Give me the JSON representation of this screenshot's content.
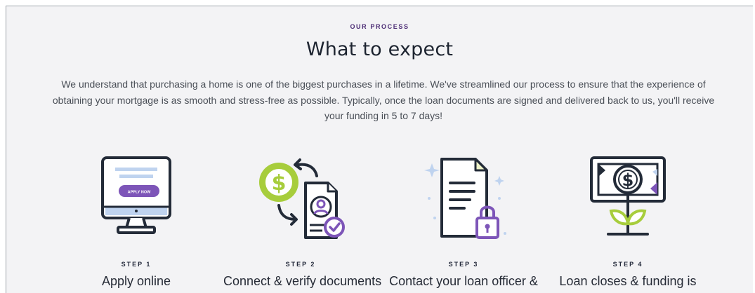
{
  "section": {
    "eyebrow": "OUR PROCESS",
    "title": "What to expect",
    "intro": "We understand that purchasing a home is one of the biggest purchases in a lifetime. We've streamlined our process to ensure that the experience of obtaining your mortgage is as smooth and stress-free as possible. Typically, once the loan documents are signed and delivered back to us, you'll receive your funding in 5 to 7 days!"
  },
  "steps": [
    {
      "number": "STEP 1",
      "label": "Apply online",
      "icon": "computer-apply-icon",
      "button_text": "APPLY NOW"
    },
    {
      "number": "STEP 2",
      "label": "Connect & verify documents",
      "icon": "verify-documents-icon"
    },
    {
      "number": "STEP 3",
      "label": "Contact your loan officer &",
      "icon": "secure-document-icon"
    },
    {
      "number": "STEP 4",
      "label": "Loan closes & funding is",
      "icon": "money-growth-icon"
    }
  ],
  "colors": {
    "purple": "#7d55b8",
    "green": "#a7cd3c",
    "dark": "#232b38",
    "light_blue": "#bfd3ef",
    "eyebrow": "#4b2b74"
  }
}
